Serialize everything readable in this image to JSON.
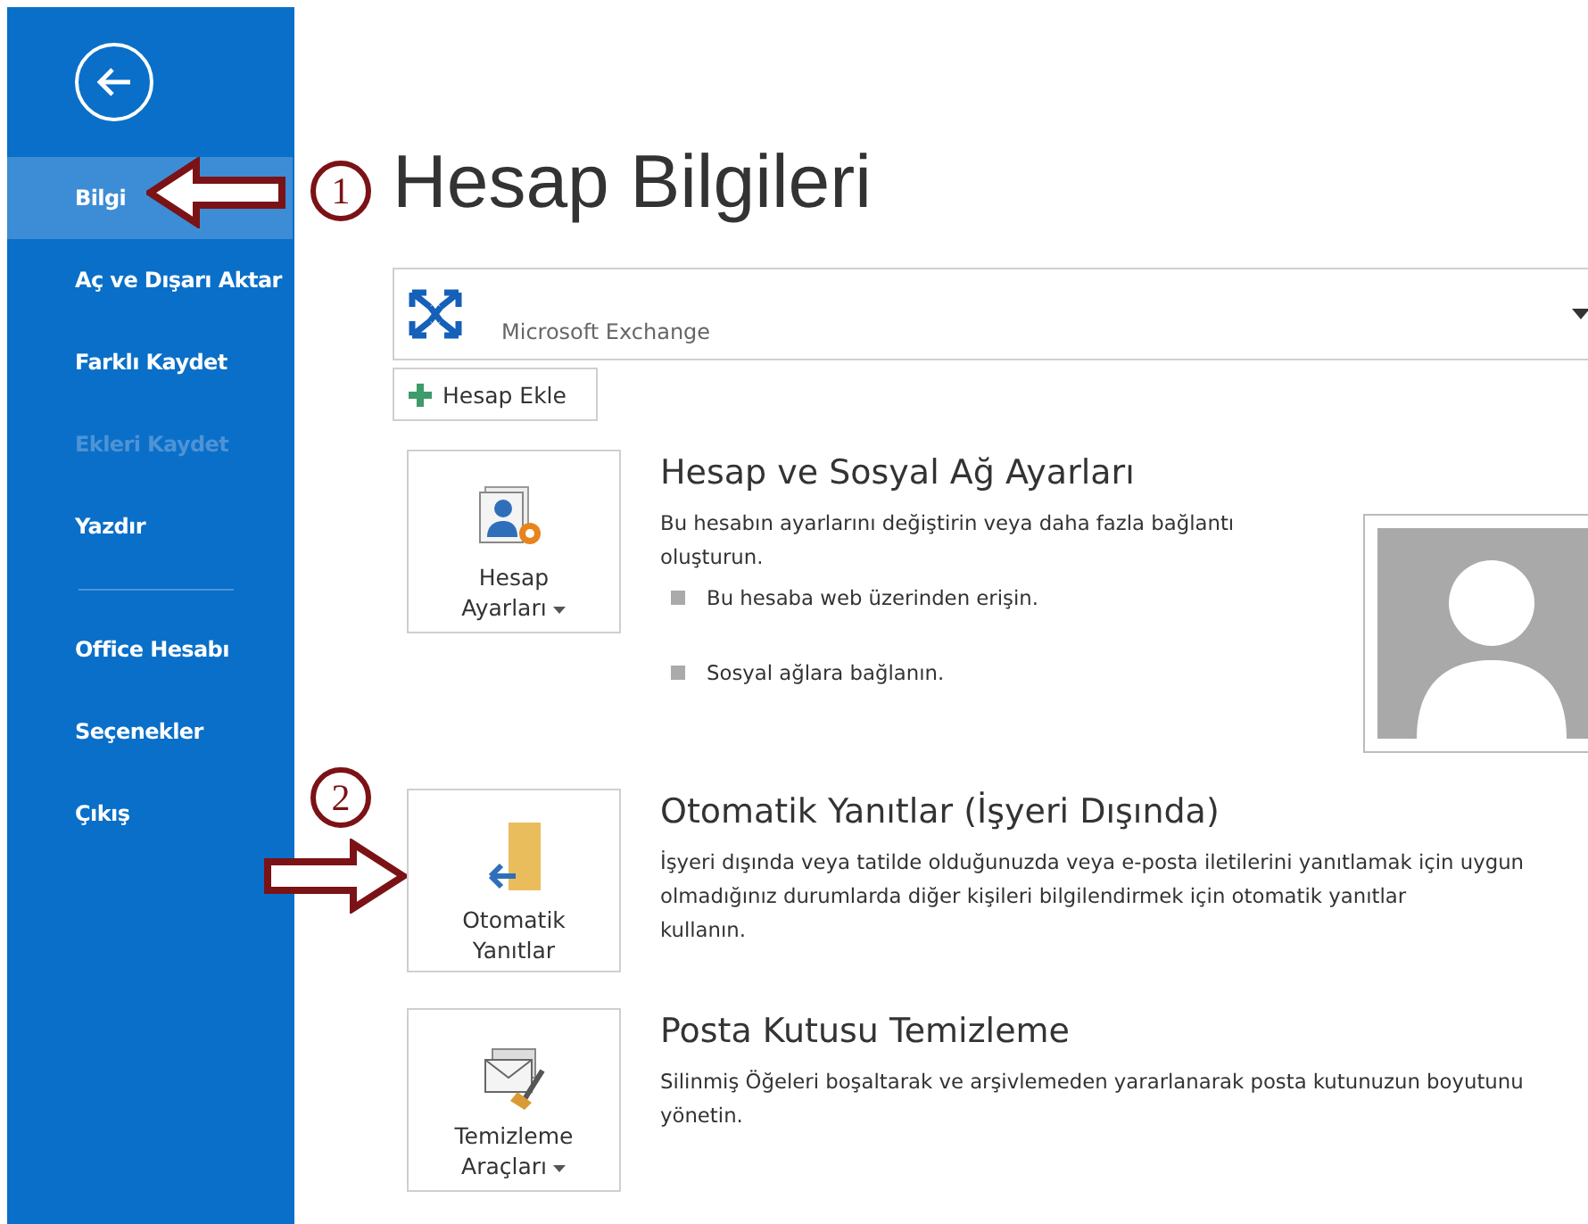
{
  "sidebar": {
    "item_groups": [
      [
        {
          "label": "Bilgi",
          "selected": true,
          "disabled": false
        },
        {
          "label": "Aç ve Dışarı Aktar",
          "selected": false,
          "disabled": false
        },
        {
          "label": "Farklı Kaydet",
          "selected": false,
          "disabled": false
        },
        {
          "label": "Ekleri Kaydet",
          "selected": false,
          "disabled": true
        },
        {
          "label": "Yazdır",
          "selected": false,
          "disabled": false
        }
      ],
      [
        {
          "label": "Office Hesabı",
          "selected": false,
          "disabled": false
        },
        {
          "label": "Seçenekler",
          "selected": false,
          "disabled": false
        },
        {
          "label": "Çıkış",
          "selected": false,
          "disabled": false
        }
      ]
    ]
  },
  "title": "Hesap Bilgileri",
  "account": {
    "type": "Microsoft Exchange"
  },
  "add_account": {
    "label": "Hesap Ekle"
  },
  "sections": [
    {
      "kind": "account-settings",
      "button_label": "Hesap Ayarları",
      "has_menu": true,
      "title": "Hesap ve Sosyal Ağ Ayarları",
      "description": "Bu hesabın ayarlarını değiştirin veya daha fazla bağlantı oluşturun.",
      "bullets": [
        "Bu hesaba web üzerinden erişin.",
        "Sosyal ağlara bağlanın."
      ],
      "profile_photo": true
    },
    {
      "kind": "auto-reply",
      "button_label": "Otomatik Yanıtlar",
      "has_menu": false,
      "title": "Otomatik Yanıtlar (İşyeri Dışında)",
      "description": "İşyeri dışında veya tatilde olduğunuzda veya e-posta iletilerini yanıtlamak için uygun olmadığınız durumlarda diğer kişileri bilgilendirmek için otomatik yanıtlar",
      "description_end": "kullanın.",
      "profile_photo": false
    },
    {
      "kind": "cleanup",
      "button_label": "Temizleme Araçları",
      "has_menu": true,
      "title": "Posta Kutusu Temizleme",
      "description": "Silinmiş Öğeleri boşaltarak ve arşivlemeden yararlanarak posta kutunuzun boyutunu yönetin.",
      "profile_photo": false
    }
  ],
  "annotations": [
    {
      "label": "1"
    },
    {
      "label": "2"
    }
  ]
}
